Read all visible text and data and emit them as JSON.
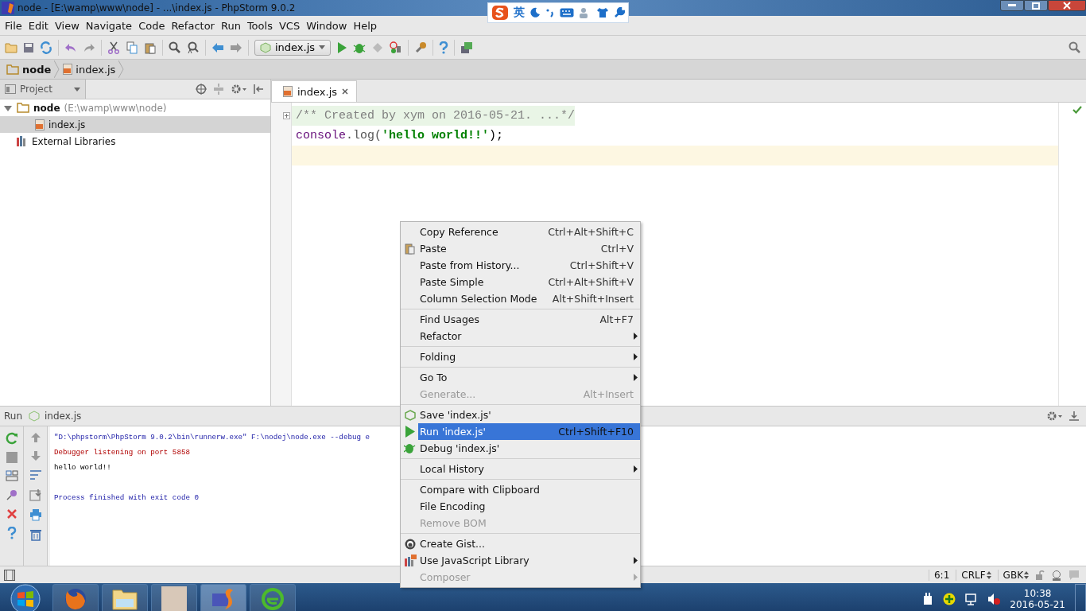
{
  "window": {
    "title": "node - [E:\\wamp\\www\\node] - ...\\index.js - PhpStorm 9.0.2"
  },
  "ime_bar": {
    "mode": "英"
  },
  "menu_bar": [
    "File",
    "Edit",
    "View",
    "Navigate",
    "Code",
    "Refactor",
    "Run",
    "Tools",
    "VCS",
    "Window",
    "Help"
  ],
  "run_config": "index.js",
  "breadcrumbs": [
    {
      "label": "node",
      "kind": "folder"
    },
    {
      "label": "index.js",
      "kind": "file"
    }
  ],
  "project_panel": {
    "title": "Project",
    "tree": [
      {
        "label": "node",
        "path": "(E:\\wamp\\www\\node)",
        "kind": "folder",
        "expanded": true,
        "selected": false,
        "children": [
          {
            "label": "index.js",
            "kind": "file",
            "selected": true
          }
        ]
      },
      {
        "label": "External Libraries",
        "kind": "library",
        "selected": false
      }
    ]
  },
  "editor": {
    "tabs": [
      {
        "label": "index.js",
        "selected": true
      }
    ],
    "lines": [
      {
        "folded": true,
        "current": false,
        "tokens": [
          {
            "kind": "comment",
            "text": "/** Created by xym on 2016-05-21. ...*/"
          }
        ]
      },
      {
        "folded": false,
        "current": false,
        "tokens": [
          {
            "kind": "identifier",
            "text": "console"
          },
          {
            "kind": "plain",
            "text": ".log("
          },
          {
            "kind": "string",
            "text": "'hello world!!'"
          },
          {
            "kind": "punct",
            "text": ");"
          }
        ]
      },
      {
        "folded": false,
        "current": true
      }
    ]
  },
  "context_menu": {
    "groups": [
      [
        {
          "label": "Copy Reference",
          "shortcut": "Ctrl+Alt+Shift+C",
          "disabled": false,
          "selected": false,
          "submenu": false
        },
        {
          "label": "Paste",
          "shortcut": "Ctrl+V",
          "disabled": false,
          "selected": false,
          "submenu": false
        },
        {
          "label": "Paste from History...",
          "shortcut": "Ctrl+Shift+V",
          "disabled": false,
          "selected": false,
          "submenu": false
        },
        {
          "label": "Paste Simple",
          "shortcut": "Ctrl+Alt+Shift+V",
          "disabled": false,
          "selected": false,
          "submenu": false
        },
        {
          "label": "Column Selection Mode",
          "shortcut": "Alt+Shift+Insert",
          "disabled": false,
          "selected": false,
          "submenu": false
        }
      ],
      [
        {
          "label": "Find Usages",
          "shortcut": "Alt+F7",
          "disabled": false,
          "selected": false,
          "submenu": false
        },
        {
          "label": "Refactor",
          "disabled": false,
          "selected": false,
          "submenu": true
        }
      ],
      [
        {
          "label": "Folding",
          "disabled": false,
          "selected": false,
          "submenu": true
        }
      ],
      [
        {
          "label": "Go To",
          "disabled": false,
          "selected": false,
          "submenu": true
        },
        {
          "label": "Generate...",
          "shortcut": "Alt+Insert",
          "disabled": true,
          "selected": false,
          "submenu": false
        }
      ],
      [
        {
          "label": "Save 'index.js'",
          "disabled": false,
          "selected": false,
          "submenu": false
        },
        {
          "label": "Run 'index.js'",
          "shortcut": "Ctrl+Shift+F10",
          "disabled": false,
          "selected": true,
          "submenu": false
        },
        {
          "label": "Debug 'index.js'",
          "disabled": false,
          "selected": false,
          "submenu": false
        }
      ],
      [
        {
          "label": "Local History",
          "disabled": false,
          "selected": false,
          "submenu": true
        }
      ],
      [
        {
          "label": "Compare with Clipboard",
          "disabled": false,
          "selected": false,
          "submenu": false
        },
        {
          "label": "File Encoding",
          "disabled": false,
          "selected": false,
          "submenu": false
        },
        {
          "label": "Remove BOM",
          "disabled": true,
          "selected": false,
          "submenu": false
        }
      ],
      [
        {
          "label": "Create Gist...",
          "disabled": false,
          "selected": false,
          "submenu": false
        },
        {
          "label": "Use JavaScript Library",
          "disabled": false,
          "selected": false,
          "submenu": true
        },
        {
          "label": "Composer",
          "disabled": true,
          "selected": false,
          "submenu": true
        }
      ]
    ]
  },
  "run_panel": {
    "title": "Run",
    "config": "index.js",
    "output": [
      {
        "kind": "command",
        "text": "\"D:\\phpstorm\\PhpStorm 9.0.2\\bin\\runnerw.exe\" F:\\nodej\\node.exe --debug e",
        "gap_before": false
      },
      {
        "kind": "error",
        "text": "Debugger listening on port 5858",
        "gap_before": false
      },
      {
        "kind": "output",
        "text": "hello world!!",
        "gap_before": false
      },
      {
        "kind": "system",
        "text": "Process finished with exit code 0",
        "gap_before": true
      }
    ]
  },
  "status_bar": {
    "position": "6:1",
    "line_separator": "CRLF",
    "encoding": "GBK"
  },
  "taskbar": {
    "time": "10:38",
    "date": "2016-05-21"
  }
}
